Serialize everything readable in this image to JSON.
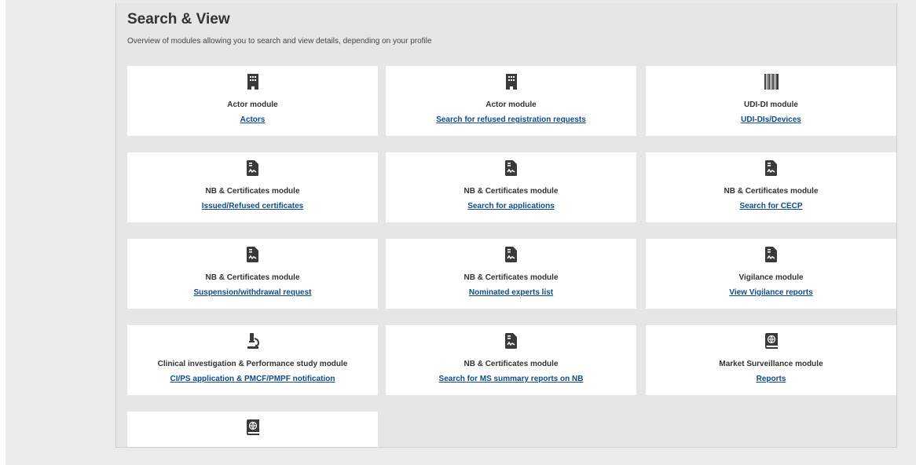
{
  "section": {
    "title": "Search & View",
    "subtitle": "Overview of modules allowing you to search and view details, depending on your profile"
  },
  "cards": [
    {
      "icon": "building-icon",
      "module": "Actor module",
      "link": "Actors"
    },
    {
      "icon": "building-icon",
      "module": "Actor module",
      "link": "Search for refused registration requests"
    },
    {
      "icon": "barcode-icon",
      "module": "UDI-DI module",
      "link": "UDI-DIs/Devices"
    },
    {
      "icon": "certificate-icon",
      "module": "NB & Certificates module",
      "link": "Issued/Refused certificates"
    },
    {
      "icon": "certificate-icon",
      "module": "NB & Certificates module",
      "link": "Search for applications"
    },
    {
      "icon": "certificate-icon",
      "module": "NB & Certificates module",
      "link": "Search for CECP"
    },
    {
      "icon": "certificate-icon",
      "module": "NB & Certificates module",
      "link": "Suspension/withdrawal request"
    },
    {
      "icon": "certificate-icon",
      "module": "NB & Certificates module",
      "link": "Nominated experts list"
    },
    {
      "icon": "certificate-icon",
      "module": "Vigilance module",
      "link": "View Vigilance reports"
    },
    {
      "icon": "microscope-icon",
      "module": "Clinical investigation & Performance study module",
      "link": "CI/PS application & PMCF/PMPF notification"
    },
    {
      "icon": "certificate-icon",
      "module": "NB & Certificates module",
      "link": "Search for MS summary reports on NB"
    },
    {
      "icon": "globe-book-icon",
      "module": "Market Surveillance module",
      "link": "Reports"
    },
    {
      "icon": "globe-book-icon",
      "module": "",
      "link": ""
    }
  ],
  "colors": {
    "page_background": "#ebebeb",
    "panel_background": "#e6e6e6",
    "card_background": "#ffffff",
    "icon": "#3a3a3a",
    "link": "#0e4b8a"
  }
}
